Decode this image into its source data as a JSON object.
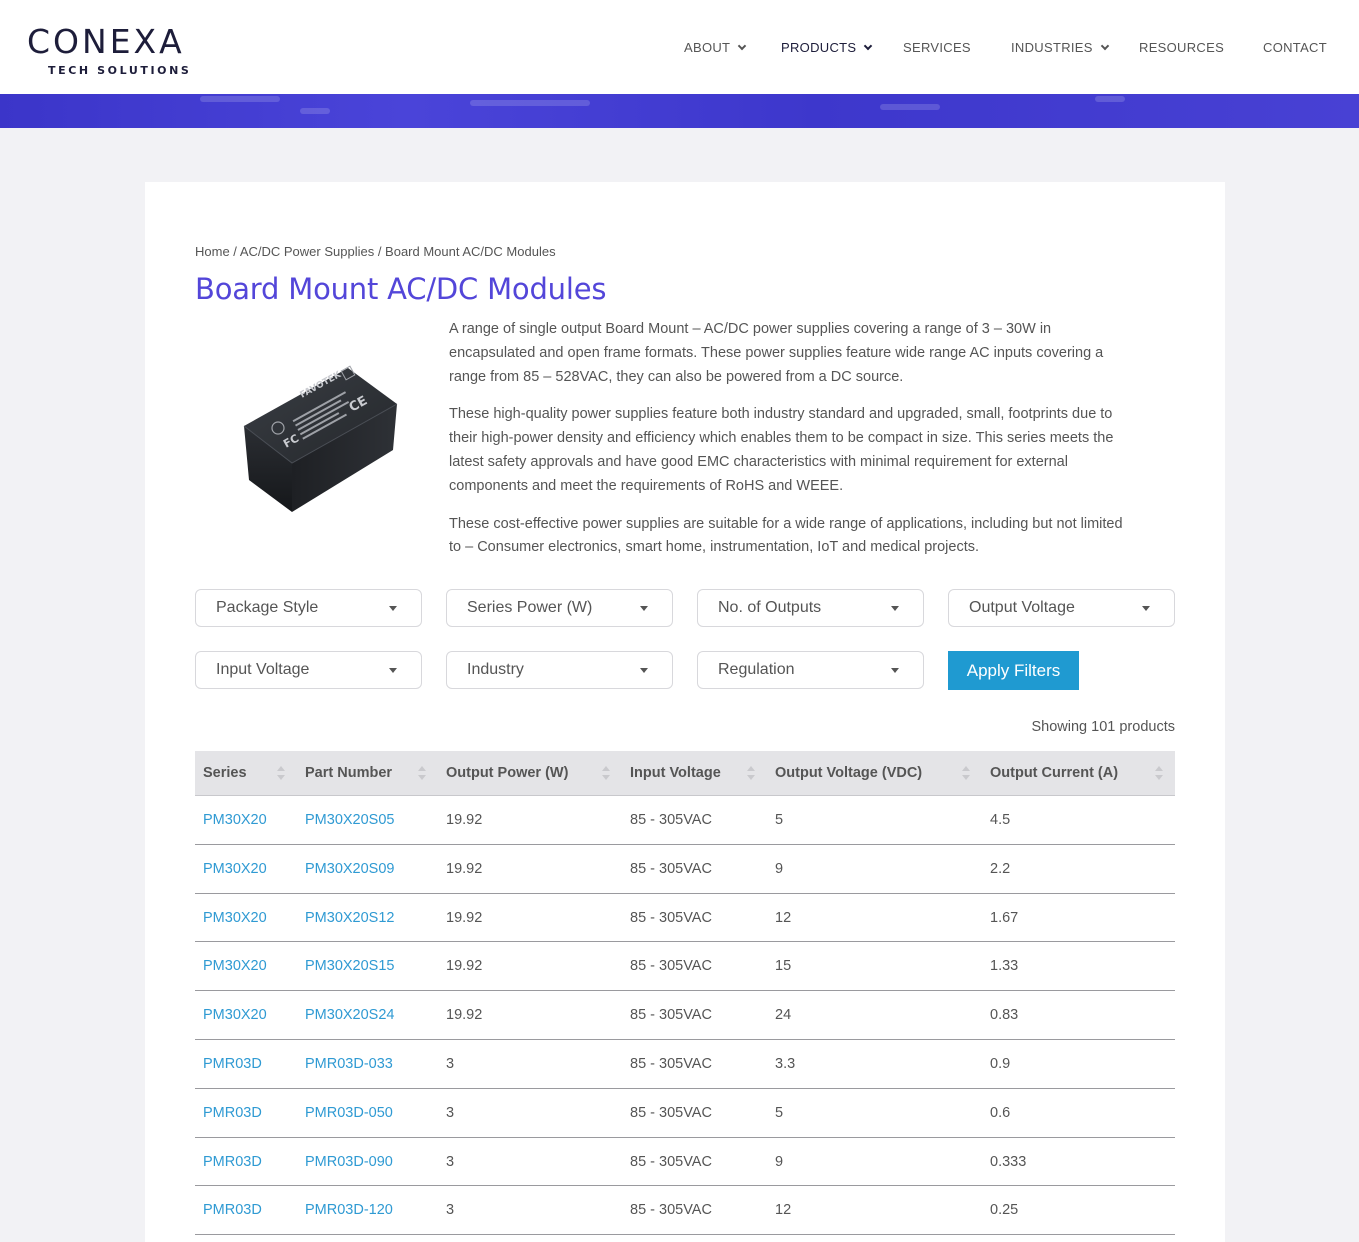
{
  "brand": {
    "name": "CONEXA",
    "tagline": "TECH SOLUTIONS"
  },
  "nav": [
    {
      "label": "ABOUT",
      "has_dropdown": true
    },
    {
      "label": "PRODUCTS",
      "has_dropdown": true,
      "active": true
    },
    {
      "label": "SERVICES",
      "has_dropdown": false
    },
    {
      "label": "INDUSTRIES",
      "has_dropdown": true
    },
    {
      "label": "RESOURCES",
      "has_dropdown": false
    },
    {
      "label": "CONTACT",
      "has_dropdown": false
    }
  ],
  "breadcrumb": {
    "home": "Home",
    "sep": " / ",
    "parent": "AC/DC Power Supplies",
    "current": "Board Mount AC/DC Modules"
  },
  "page_title": "Board Mount AC/DC Modules",
  "product_image": {
    "brand_text": "FAVOTEK",
    "icon": "power-module-photo"
  },
  "description": [
    "A range of single output Board Mount – AC/DC power supplies covering a range of 3 – 30W in encapsulated and open frame formats. These power supplies feature wide range AC inputs covering a range from 85 – 528VAC, they can also be powered from a DC source.",
    "These high-quality power supplies feature both industry standard and upgraded, small, footprints due to their high-power density and efficiency which enables them to be compact in size. This series meets the latest safety approvals and have good EMC characteristics with minimal requirement for external components and meet the requirements of RoHS and WEEE.",
    "These cost-effective power supplies are suitable for a wide range of applications, including but not limited to – Consumer electronics, smart home, instrumentation, IoT and medical projects."
  ],
  "filters": {
    "package_style": "Package Style",
    "series_power": "Series Power (W)",
    "no_of_outputs": "No. of Outputs",
    "output_voltage": "Output Voltage",
    "input_voltage": "Input Voltage",
    "industry": "Industry",
    "regulation": "Regulation",
    "apply_label": "Apply Filters"
  },
  "results_count": "Showing 101 products",
  "table": {
    "headers": [
      "Series",
      "Part Number",
      "Output Power (W)",
      "Input Voltage",
      "Output Voltage (VDC)",
      "Output Current (A)"
    ],
    "rows": [
      [
        "PM30X20",
        "PM30X20S05",
        "19.92",
        "85 - 305VAC",
        "5",
        "4.5"
      ],
      [
        "PM30X20",
        "PM30X20S09",
        "19.92",
        "85 - 305VAC",
        "9",
        "2.2"
      ],
      [
        "PM30X20",
        "PM30X20S12",
        "19.92",
        "85 - 305VAC",
        "12",
        "1.67"
      ],
      [
        "PM30X20",
        "PM30X20S15",
        "19.92",
        "85 - 305VAC",
        "15",
        "1.33"
      ],
      [
        "PM30X20",
        "PM30X20S24",
        "19.92",
        "85 - 305VAC",
        "24",
        "0.83"
      ],
      [
        "PMR03D",
        "PMR03D-033",
        "3",
        "85 - 305VAC",
        "3.3",
        "0.9"
      ],
      [
        "PMR03D",
        "PMR03D-050",
        "3",
        "85 - 305VAC",
        "5",
        "0.6"
      ],
      [
        "PMR03D",
        "PMR03D-090",
        "3",
        "85 - 305VAC",
        "9",
        "0.333"
      ],
      [
        "PMR03D",
        "PMR03D-120",
        "3",
        "85 - 305VAC",
        "12",
        "0.25"
      ]
    ]
  },
  "colors": {
    "accent_title": "#5346d9",
    "link": "#2f9ad3",
    "button": "#1f9ad1",
    "banner": "#3f39cf"
  }
}
